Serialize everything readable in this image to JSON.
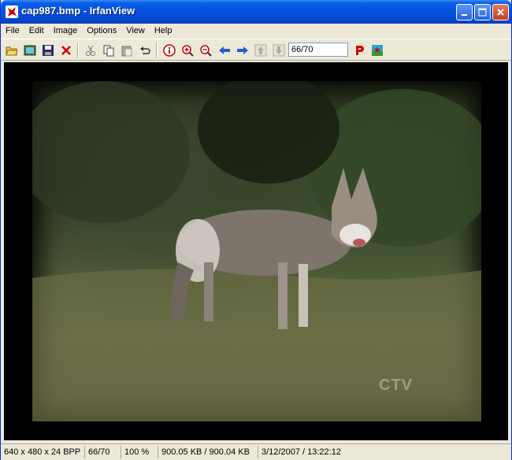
{
  "window": {
    "title": "cap987.bmp - IrfanView"
  },
  "menu": {
    "items": [
      "File",
      "Edit",
      "Image",
      "Options",
      "View",
      "Help"
    ]
  },
  "toolbar": {
    "page_value": "66/70"
  },
  "watermark": {
    "text": "CTV"
  },
  "status": {
    "dimensions": "640 x 480 x 24 BPP",
    "page": "66/70",
    "zoom": "100 %",
    "size": "900.05 KB / 900.04 KB",
    "datetime": "3/12/2007 / 13:22:12"
  },
  "colors": {
    "titlebar": "#0553e0",
    "chrome": "#ece9d8",
    "canvas": "#000000"
  }
}
